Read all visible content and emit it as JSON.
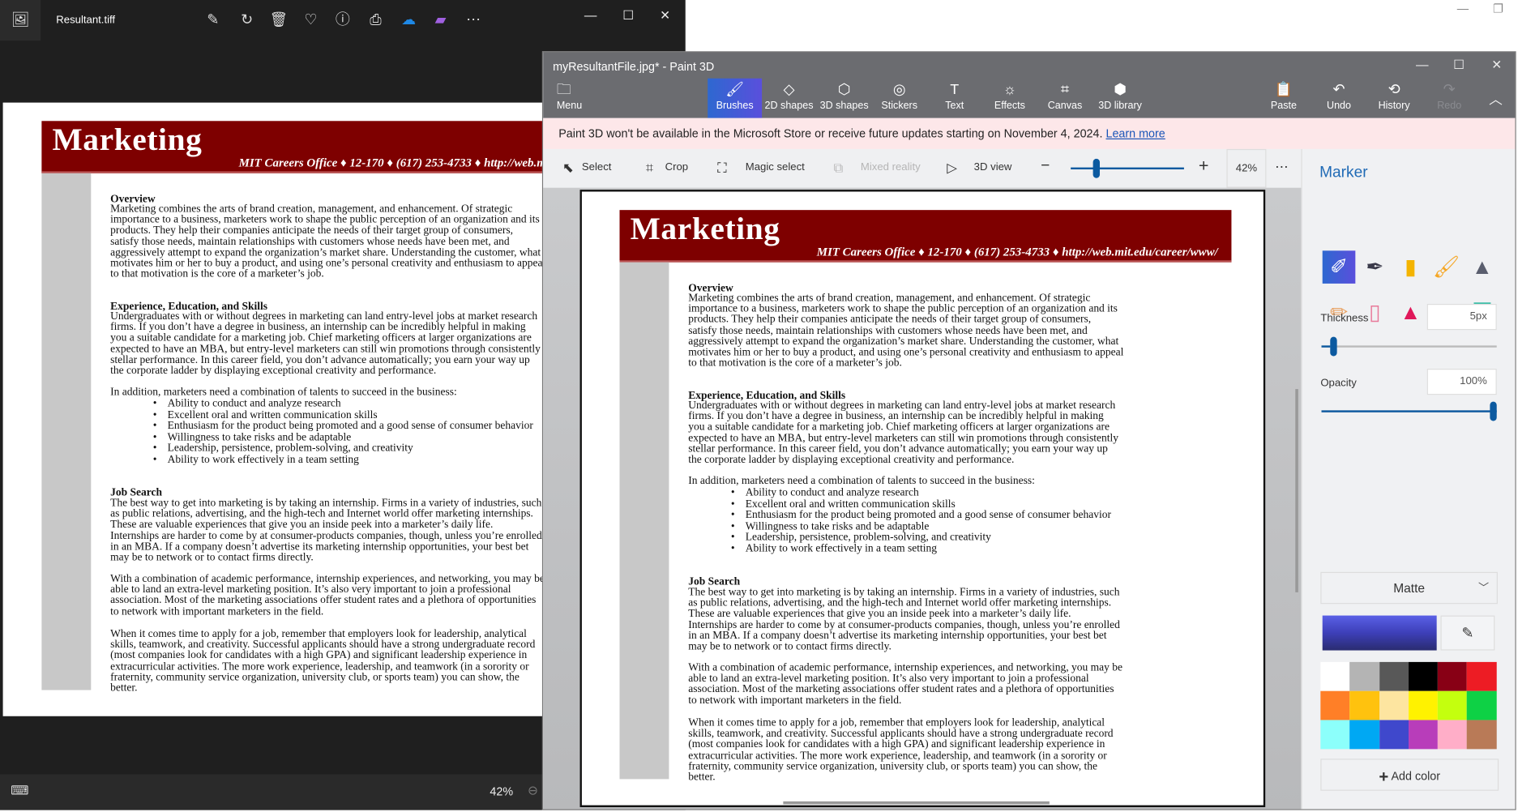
{
  "photos": {
    "title": "Resultant.tiff",
    "toolbar_icons": [
      "edit-image-icon",
      "rotate-icon",
      "delete-icon",
      "favorite-heart-icon",
      "info-icon",
      "print-icon",
      "onedrive-cloud-icon",
      "clipchamp-icon",
      "more-icon"
    ],
    "zoom": "42%"
  },
  "paint": {
    "title": "myResultantFile.jpg* - Paint 3D",
    "menu": "Menu",
    "ribbon": [
      {
        "label": "Brushes",
        "icon": "brush-icon",
        "glyph": "🖌",
        "active": true
      },
      {
        "label": "2D shapes",
        "icon": "2d-shapes-icon",
        "glyph": "◇"
      },
      {
        "label": "3D shapes",
        "icon": "3d-shapes-icon",
        "glyph": "⬡"
      },
      {
        "label": "Stickers",
        "icon": "stickers-icon",
        "glyph": "◎"
      },
      {
        "label": "Text",
        "icon": "text-icon",
        "glyph": "T"
      },
      {
        "label": "Effects",
        "icon": "effects-icon",
        "glyph": "☼"
      },
      {
        "label": "Canvas",
        "icon": "canvas-icon",
        "glyph": "⌗"
      },
      {
        "label": "3D library",
        "icon": "3d-library-icon",
        "glyph": "⬢"
      }
    ],
    "right_ribbon": [
      {
        "label": "Paste",
        "icon": "paste-icon",
        "glyph": "📋"
      },
      {
        "label": "Undo",
        "icon": "undo-icon",
        "glyph": "↶"
      },
      {
        "label": "History",
        "icon": "history-icon",
        "glyph": "⟲"
      },
      {
        "label": "Redo",
        "icon": "redo-icon",
        "glyph": "↷",
        "disabled": true
      }
    ],
    "notice": "Paint 3D won't be available in the Microsoft Store or receive future updates starting on November 4, 2024.",
    "notice_link": "Learn more",
    "tools": {
      "select": "Select",
      "crop": "Crop",
      "magic_select": "Magic select",
      "mixed_reality": "Mixed reality",
      "view_3d": "3D view"
    },
    "zoom": "42%",
    "zoom_slider_fraction": 0.2,
    "panel": {
      "title": "Marker",
      "brushes": [
        "marker-icon",
        "calligraphy-pen-icon",
        "oil-brush-icon",
        "watercolor-icon",
        "pixel-pen-icon",
        "pencil-icon",
        "eraser-icon",
        "crayon-icon",
        "spray-can-icon",
        "fill-bucket-icon"
      ],
      "thickness_label": "Thickness",
      "thickness": "5px",
      "thickness_fraction": 0.05,
      "opacity_label": "Opacity",
      "opacity": "100%",
      "opacity_fraction": 1.0,
      "finish": "Matte",
      "current_color": "#3d3fb8",
      "palette": [
        "#ffffff",
        "#b4b4b4",
        "#585858",
        "#000000",
        "#880015",
        "#ed1c24",
        "#ff7f27",
        "#ffc20e",
        "#fde5a0",
        "#fff200",
        "#c4ff0e",
        "#0ed145",
        "#8cfffb",
        "#00a8f3",
        "#3f48cc",
        "#b83dba",
        "#ffaec8",
        "#b97a57"
      ],
      "add_color": "Add color"
    }
  },
  "document": {
    "title": "Marketing",
    "subtitle": "MIT Careers Office ♦ 12-170 ♦ (617) 253-4733 ♦ http://web.mit.edu/career/www/",
    "blocks": [
      {
        "type": "h",
        "lines": [
          "Overview"
        ]
      },
      {
        "type": "p",
        "lines": [
          "Marketing combines the arts of brand creation, management, and enhancement.  Of strategic",
          "importance to a business, marketers work to shape the public perception of an organization and its",
          "products.  They help their companies anticipate the needs of their target group of consumers,",
          "satisfy those needs, maintain relationships with customers whose needs have been met, and",
          "aggressively attempt to expand the organization’s market share.  Understanding the customer, what",
          "motivates him or her to buy a product, and using one’s personal creativity and enthusiasm to appeal",
          "to that motivation is the core of a marketer’s job."
        ]
      },
      {
        "type": "h",
        "lines": [
          "Experience, Education, and Skills"
        ]
      },
      {
        "type": "p",
        "lines": [
          "Undergraduates with or without degrees in marketing can land entry-level jobs at market research",
          "firms.  If you don’t have a degree in business, an internship can be incredibly helpful in making",
          "you a suitable candidate for a marketing job.  Chief marketing officers at larger organizations are",
          "expected to have an MBA, but entry-level marketers can still win promotions through consistently",
          "stellar performance.  In this career field, you don’t advance automatically; you earn your way up",
          "the corporate ladder by displaying exceptional creativity and performance."
        ]
      },
      {
        "type": "p",
        "lines": [
          "In addition, marketers need a combination of talents to succeed in the business:"
        ]
      },
      {
        "type": "b",
        "lines": [
          "Ability to conduct and analyze research",
          "Excellent oral and written communication skills",
          "Enthusiasm for the product being promoted and a good sense of consumer behavior",
          "Willingness to take risks and be adaptable",
          "Leadership, persistence, problem-solving, and creativity",
          "Ability to work effectively in a team setting"
        ]
      },
      {
        "type": "h",
        "lines": [
          "Job Search"
        ]
      },
      {
        "type": "p",
        "lines": [
          "The best way to get into marketing is by taking an internship.  Firms in a variety of industries, such",
          "as public relations, advertising, and the high-tech and Internet world offer marketing internships.",
          "These are valuable experiences that give you an inside peek into a marketer’s daily life.",
          "Internships are harder to come by at consumer-products companies, though, unless you’re enrolled",
          "in an MBA.  If a company doesn’t advertise its marketing internship opportunities, your best bet",
          "may be to network or to contact firms directly."
        ]
      },
      {
        "type": "p",
        "lines": [
          "With a combination of academic performance, internship experiences, and networking, you may be",
          "able to land an extra-level marketing position.  It’s also very important to join a professional",
          "association.  Most of the marketing associations offer student rates and a plethora of opportunities",
          "to network with important marketers in the field."
        ]
      },
      {
        "type": "p",
        "lines": [
          "When it comes time to apply for a job, remember that employers look for leadership, analytical",
          "skills, teamwork, and creativity.  Successful applicants should have a strong undergraduate record",
          "(most companies look for candidates with a high GPA) and significant leadership experience in",
          "extracurricular activities.  The more work experience, leadership, and teamwork (in a sorority or",
          "fraternity, community service organization, university club, or sports team) you can show, the",
          "better."
        ]
      }
    ]
  }
}
